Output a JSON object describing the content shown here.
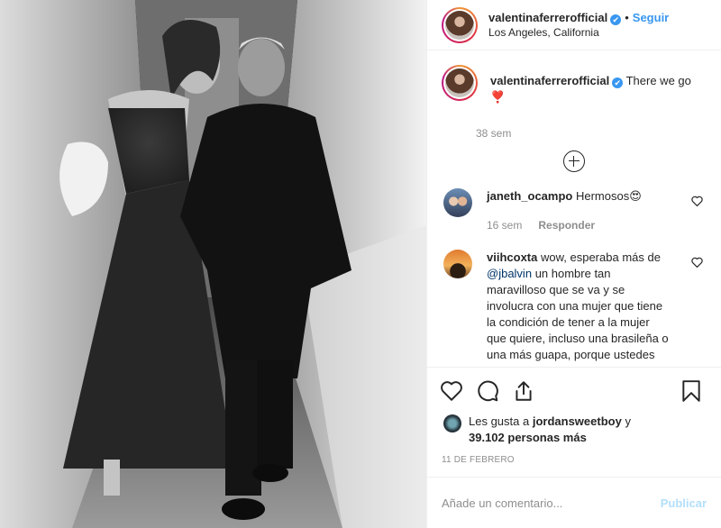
{
  "header": {
    "username": "valentinaferrerofficial",
    "verified_glyph": "✔",
    "follow_label": "Seguir",
    "separator": "•",
    "location": "Los Angeles, California"
  },
  "caption": {
    "username": "valentinaferrerofficial",
    "text": "There we go",
    "emoji": "❣️",
    "time": "38 sem"
  },
  "load_more_icon": "plus-circle-icon",
  "comments": [
    {
      "username": "janeth_ocampo",
      "text": "Hermosos😍",
      "time": "16 sem",
      "reply_label": "Responder"
    },
    {
      "username": "viihcoxta",
      "text_before": "wow, esperaba más de",
      "mention": "@jbalvin",
      "text_after": "un hombre tan maravilloso que se va y se involucra con una mujer que tiene la condición de tener a la mujer que quiere, incluso una brasileña o una más guapa, porque ustedes"
    }
  ],
  "actions": {
    "like_icon": "heart-icon",
    "comment_icon": "comment-icon",
    "share_icon": "share-icon",
    "save_icon": "bookmark-icon"
  },
  "likes": {
    "prefix": "Les gusta a",
    "user": "jordansweetboy",
    "conjunction": "y",
    "count": "39.102 personas más"
  },
  "date": "11 DE FEBRERO",
  "add_comment": {
    "placeholder": "Añade un comentario...",
    "publish_label": "Publicar"
  },
  "colors": {
    "accent_blue": "#3897f0",
    "publish_disabled": "#b2dffc",
    "muted_text": "#8e8e8e",
    "border": "#efefef"
  }
}
